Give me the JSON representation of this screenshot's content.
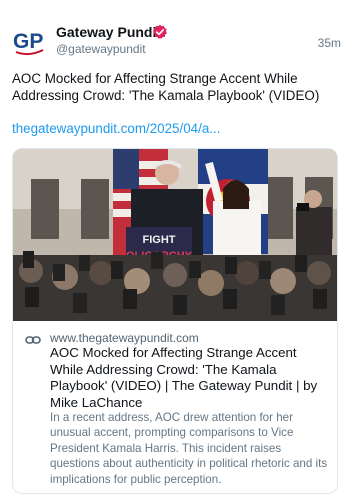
{
  "author": {
    "name": "Gateway Pundit",
    "handle": "@gatewaypundit",
    "avatar_text": "GP",
    "verified": true,
    "time": "35m"
  },
  "post": {
    "text": "AOC Mocked for Affecting Strange Accent While Addressing Crowd: 'The Kamala Playbook' (VIDEO)",
    "link": "thegatewaypundit.com/2025/04/a..."
  },
  "card": {
    "image_sign_text": [
      "FIGHT",
      "OLIGARCHY"
    ],
    "domain": "www.thegatewaypundit.com",
    "title": "AOC Mocked for Affecting Strange Accent While Addressing Crowd: 'The Kamala Playbook' (VIDEO) | The Gateway Pundit | by Mike LaChance",
    "description": "In a recent address, AOC drew attention for her unusual accent, prompting comparisons to Vice President Kamala Harris. This incident raises questions about authenticity in political rhetoric and its implications for public perception."
  },
  "colors": {
    "brand_blue": "#1c4b8c",
    "verified": "#e0245e",
    "link": "#1d9bf0",
    "muted": "#657786"
  },
  "icons": [
    "verified-badge-icon",
    "link-icon"
  ]
}
